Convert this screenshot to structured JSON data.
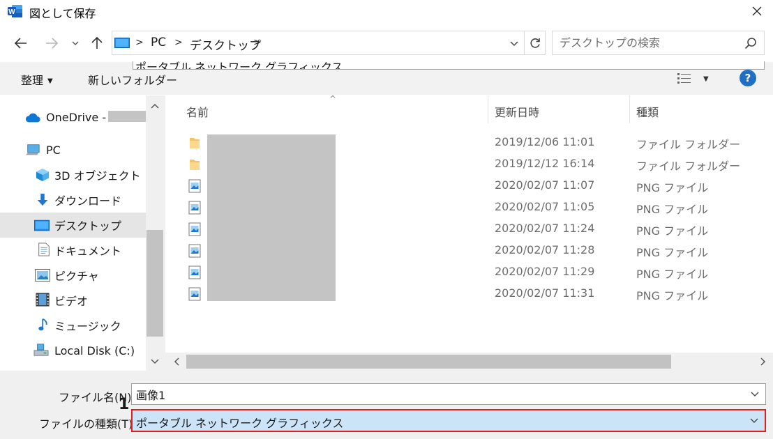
{
  "window": {
    "title": "図として保存",
    "app_icon_letter": "W"
  },
  "nav": {
    "breadcrumbs": [
      "PC",
      "デスクトップ"
    ],
    "search_placeholder": "デスクトップの検索"
  },
  "toolbar": {
    "organize_label": "整理",
    "new_folder_label": "新しいフォルダー",
    "help_label": "?"
  },
  "sidebar": {
    "items": [
      {
        "label": "OneDrive -",
        "icon": "cloud-icon"
      },
      {
        "label": "PC",
        "icon": "computer-icon"
      },
      {
        "label": "3D オブジェクト",
        "icon": "cube-icon"
      },
      {
        "label": "ダウンロード",
        "icon": "download-arrow-icon"
      },
      {
        "label": "デスクトップ",
        "icon": "desktop-icon",
        "selected": true
      },
      {
        "label": "ドキュメント",
        "icon": "document-icon"
      },
      {
        "label": "ピクチャ",
        "icon": "picture-icon"
      },
      {
        "label": "ビデオ",
        "icon": "film-icon"
      },
      {
        "label": "ミュージック",
        "icon": "music-note-icon"
      },
      {
        "label": "Local Disk (C:)",
        "icon": "disk-drive-icon"
      }
    ]
  },
  "filelist": {
    "columns": [
      "名前",
      "更新日時",
      "種類"
    ],
    "rows": [
      {
        "date": "2019/12/06 11:01",
        "type": "ファイル フォルダー",
        "icon": "folder-icon"
      },
      {
        "date": "2019/12/12 16:14",
        "type": "ファイル フォルダー",
        "icon": "folder-icon"
      },
      {
        "date": "2020/02/07 11:07",
        "type": "PNG ファイル",
        "icon": "image-file-icon"
      },
      {
        "date": "2020/02/07 11:05",
        "type": "PNG ファイル",
        "icon": "image-file-icon"
      },
      {
        "date": "2020/02/07 11:24",
        "type": "PNG ファイル",
        "icon": "image-file-icon"
      },
      {
        "date": "2020/02/07 11:28",
        "type": "PNG ファイル",
        "icon": "image-file-icon"
      },
      {
        "date": "2020/02/07 11:29",
        "type": "PNG ファイル",
        "icon": "image-file-icon"
      },
      {
        "date": "2020/02/07 11:31",
        "type": "PNG ファイル",
        "icon": "image-file-icon"
      }
    ]
  },
  "form": {
    "filename_label": "ファイル名(N):",
    "filename_value": "画像1",
    "filetype_label": "ファイルの種類(T):",
    "filetype_value": "ポータブル ネットワーク グラフィックス",
    "dropdown_option": "ポータブル ネットワーク グラフィックス"
  },
  "annotation": {
    "step_number": "1"
  },
  "colors": {
    "accent": "#1f6fc6",
    "highlight_border": "#e21d1d",
    "selected_field": "#cce4f7"
  }
}
